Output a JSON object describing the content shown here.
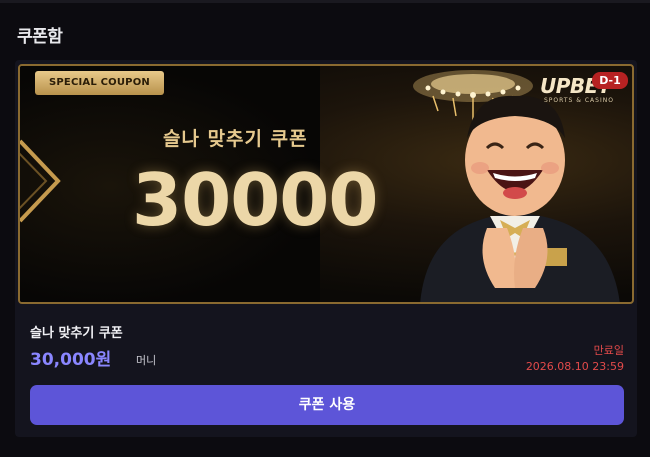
{
  "header": {
    "title": "쿠폰함"
  },
  "coupon": {
    "tag": "SPECIAL COUPON",
    "banner_title": "슬나 맞추기 쿠폰",
    "banner_amount": "30000",
    "brand_logo": "UPBET",
    "brand_sub": "SPORTS & CASINO",
    "dday": "D-1",
    "name": "슬나 맞추기 쿠폰",
    "amount": "30,000원",
    "unit": "머니",
    "expire_label": "만료일",
    "expire_date": "2026.08.10 23:59",
    "use_button_label": "쿠폰 사용"
  },
  "colors": {
    "background": "#0c0b10",
    "card": "#14141e",
    "accent_button": "#5d55d8",
    "amount_text": "#8a86ff",
    "expire_text": "#e24a4a",
    "gold": "#ecd7a8"
  }
}
